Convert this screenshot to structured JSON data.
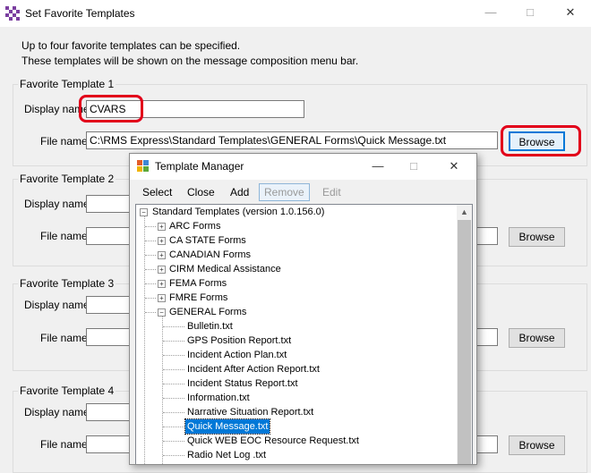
{
  "main_window": {
    "title": "Set Favorite Templates",
    "intro_line1": "Up to four favorite templates can be specified.",
    "intro_line2": "These templates will be shown on the message composition menu bar.",
    "display_name_label": "Display name",
    "display_name_label_colon": "Display name:",
    "file_name_label": "File name:",
    "browse_label": "Browse",
    "templates": [
      {
        "title": "Favorite Template 1",
        "display_name": "CVARS",
        "file_name": "C:\\RMS Express\\Standard Templates\\GENERAL Forms\\Quick Message.txt"
      },
      {
        "title": "Favorite Template 2",
        "display_name": "",
        "file_name": ""
      },
      {
        "title": "Favorite Template 3",
        "display_name": "",
        "file_name": ""
      },
      {
        "title": "Favorite Template 4",
        "display_name": "",
        "file_name": ""
      }
    ]
  },
  "template_manager": {
    "title": "Template Manager",
    "menu": {
      "select": "Select",
      "close": "Close",
      "add": "Add",
      "remove": "Remove",
      "edit": "Edit"
    },
    "tree": {
      "root": "Standard Templates (version 1.0.156.0)",
      "folders": [
        "ARC Forms",
        "CA STATE Forms",
        "CANADIAN Forms",
        "CIRM Medical Assistance",
        "FEMA Forms",
        "FMRE Forms",
        "GENERAL Forms"
      ],
      "general_files": [
        "Bulletin.txt",
        "GPS Position Report.txt",
        "Incident Action Plan.txt",
        "Incident After Action Report.txt",
        "Incident Status Report.txt",
        "Information.txt",
        "Narrative Situation Report.txt",
        "Quick Message.txt",
        "Quick WEB EOC Resource Request.txt",
        "Radio Net Log .txt"
      ],
      "selected": "Quick Message.txt"
    }
  },
  "colors": {
    "highlight_red": "#e2001a",
    "selection_blue": "#0078d7"
  }
}
